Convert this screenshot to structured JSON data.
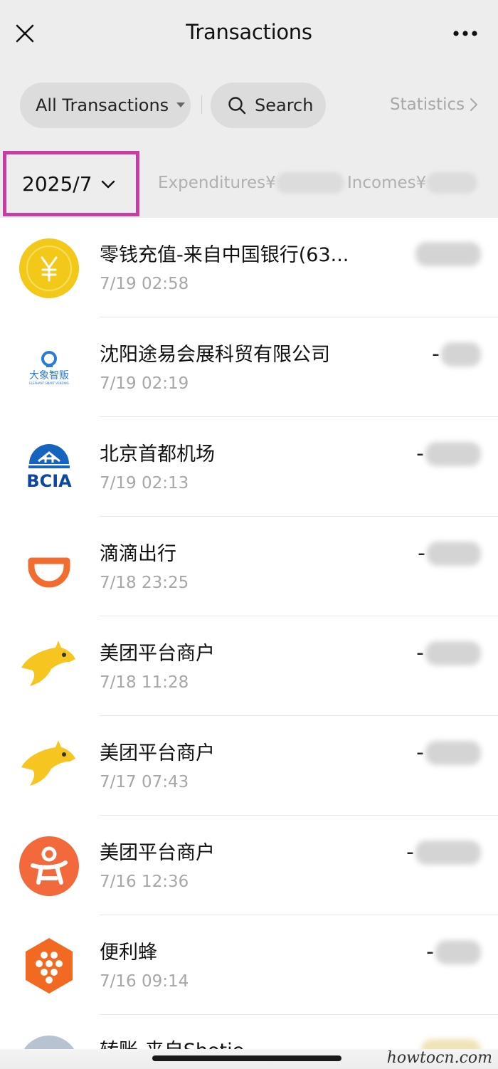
{
  "header": {
    "title": "Transactions"
  },
  "filters": {
    "all_label": "All Transactions",
    "search_label": "Search",
    "statistics_label": "Statistics"
  },
  "summary": {
    "month": "2025/7",
    "expenditures_label": "Expenditures¥",
    "incomes_label": "Incomes¥"
  },
  "transactions": [
    {
      "name": "零钱充值-来自中国银行(63...",
      "time": "7/19 02:58",
      "icon": "yuan-coin-icon",
      "sign": ""
    },
    {
      "name": "沈阳途易会展科贸有限公司",
      "time": "7/19 02:19",
      "icon": "daxiang-zhifan-logo-icon",
      "sign": "-"
    },
    {
      "name": "北京首都机场",
      "time": "7/19 02:13",
      "icon": "bcia-logo-icon",
      "sign": "-"
    },
    {
      "name": "滴滴出行",
      "time": "7/18 23:25",
      "icon": "didi-logo-icon",
      "sign": "-"
    },
    {
      "name": "美团平台商户",
      "time": "7/18 11:28",
      "icon": "meituan-kangaroo-icon",
      "sign": "-"
    },
    {
      "name": "美团平台商户",
      "time": "7/17 07:43",
      "icon": "meituan-kangaroo-icon",
      "sign": "-"
    },
    {
      "name": "美团平台商户",
      "time": "7/16 12:36",
      "icon": "dianping-logo-icon",
      "sign": "-"
    },
    {
      "name": "便利蜂",
      "time": "7/16 09:14",
      "icon": "bianlifeng-logo-icon",
      "sign": "-"
    },
    {
      "name": "转账-来自Shotie",
      "time": "",
      "icon": "avatar-icon",
      "sign": ""
    }
  ],
  "watermark": "howtocn.com",
  "colors": {
    "highlight_box": "#c63ea3",
    "background": "#ededed",
    "list_background": "#ffffff"
  }
}
